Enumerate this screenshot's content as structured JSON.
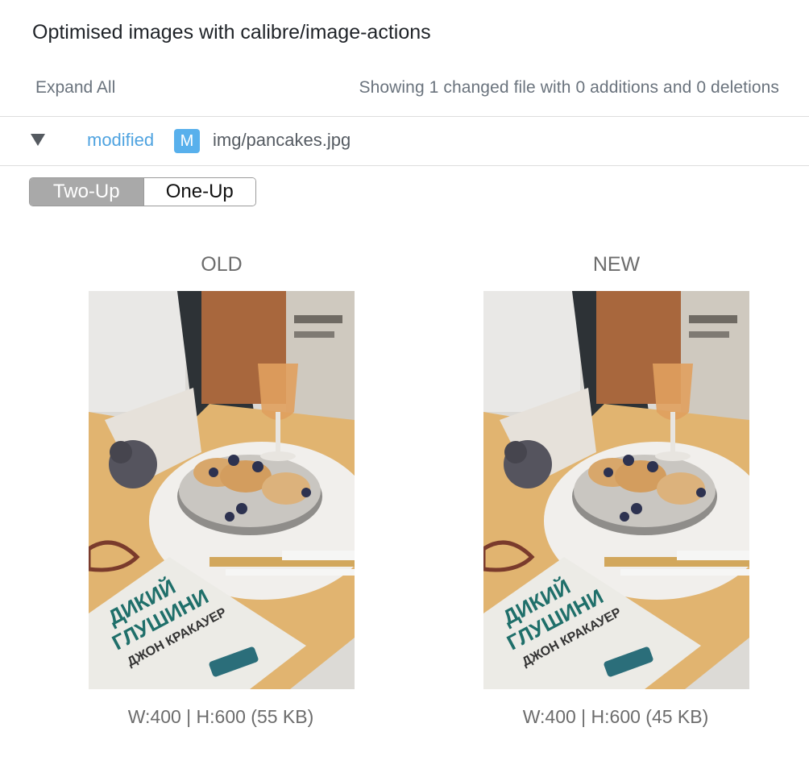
{
  "header": {
    "title": "Optimised images with calibre/image-actions"
  },
  "summary": {
    "expand_all": "Expand All",
    "showing": "Showing 1 changed file with 0 additions and 0 deletions"
  },
  "file": {
    "status": "modified",
    "badge": "M",
    "path": "img/pancakes.jpg"
  },
  "view_modes": {
    "two_up": "Two-Up",
    "one_up": "One-Up",
    "active": "Two-Up"
  },
  "compare": {
    "old": {
      "label": "OLD",
      "meta": "W:400 | H:600 (55 KB)"
    },
    "new": {
      "label": "NEW",
      "meta": "W:400 | H:600 (45 KB)"
    }
  },
  "image": {
    "subject": "pancakes-photo",
    "book_lines": [
      "ДИКИЙ",
      "ГЛУШИНИ",
      "ДЖОН КРАКАУЕР"
    ]
  },
  "colors": {
    "accent": "#4fa3e0",
    "badge": "#58b0ec",
    "active_tab": "#a9a9a9"
  }
}
